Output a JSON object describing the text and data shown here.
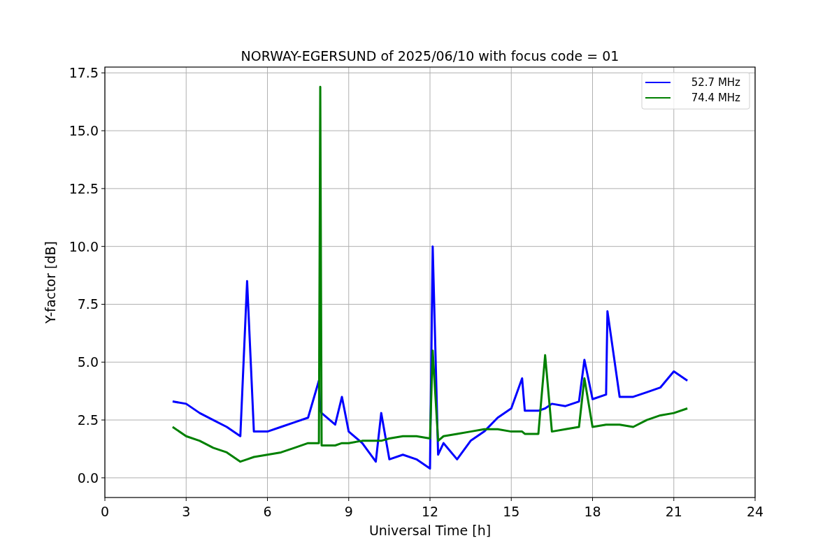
{
  "chart_data": {
    "type": "line",
    "title": "NORWAY-EGERSUND of 2025/06/10 with focus code = 01",
    "xlabel": "Universal Time [h]",
    "ylabel": "Y-factor [dB]",
    "x": [
      2.5,
      3,
      3.5,
      4,
      4.5,
      5,
      5.25,
      5.5,
      6,
      6.5,
      7,
      7.5,
      7.9,
      7.95,
      8,
      8.5,
      8.75,
      9,
      9.5,
      10,
      10.2,
      10.5,
      11,
      11.5,
      12,
      12.1,
      12.3,
      12.5,
      13,
      13.5,
      14,
      14.5,
      15,
      15.4,
      15.5,
      16,
      16.25,
      16.5,
      17,
      17.5,
      17.7,
      18,
      18.5,
      18.55,
      19,
      19.5,
      20,
      20.5,
      21,
      21.5
    ],
    "series": [
      {
        "name": "52.7 MHz",
        "color": "#0000ff",
        "values": [
          3.3,
          3.2,
          2.8,
          2.5,
          2.2,
          1.8,
          8.5,
          2.0,
          2.0,
          2.2,
          2.4,
          2.6,
          4.2,
          2.9,
          2.8,
          2.3,
          3.5,
          2.0,
          1.5,
          0.7,
          2.8,
          0.8,
          1.0,
          0.8,
          0.4,
          10.0,
          1.0,
          1.5,
          0.8,
          1.6,
          2.0,
          2.6,
          3.0,
          4.3,
          2.9,
          2.9,
          3.0,
          3.2,
          3.1,
          3.3,
          5.1,
          3.4,
          3.6,
          7.2,
          3.5,
          3.5,
          3.7,
          3.9,
          4.6,
          4.2
        ]
      },
      {
        "name": "74.4 MHz",
        "color": "#008000",
        "values": [
          2.2,
          1.8,
          1.6,
          1.3,
          1.1,
          0.7,
          0.8,
          0.9,
          1.0,
          1.1,
          1.3,
          1.5,
          1.5,
          16.9,
          1.4,
          1.4,
          1.5,
          1.5,
          1.6,
          1.6,
          1.6,
          1.7,
          1.8,
          1.8,
          1.7,
          5.5,
          1.6,
          1.8,
          1.9,
          2.0,
          2.1,
          2.1,
          2.0,
          2.0,
          1.9,
          1.9,
          5.3,
          2.0,
          2.1,
          2.2,
          4.3,
          2.2,
          2.3,
          2.3,
          2.3,
          2.2,
          2.5,
          2.7,
          2.8,
          3.0
        ]
      }
    ],
    "grid": true,
    "legend": true,
    "xlim": [
      0,
      24
    ],
    "ylim": [
      -0.85,
      17.75
    ],
    "xticks": [
      0,
      3,
      6,
      9,
      12,
      15,
      18,
      21,
      24
    ],
    "yticks": [
      {
        "value": 0,
        "label": "0.0"
      },
      {
        "value": 2.5,
        "label": "2.5"
      },
      {
        "value": 5,
        "label": "5.0"
      },
      {
        "value": 7.5,
        "label": "7.5"
      },
      {
        "value": 10,
        "label": "10.0"
      },
      {
        "value": 12.5,
        "label": "12.5"
      },
      {
        "value": 15,
        "label": "15.0"
      },
      {
        "value": 17.5,
        "label": "17.5"
      }
    ]
  }
}
